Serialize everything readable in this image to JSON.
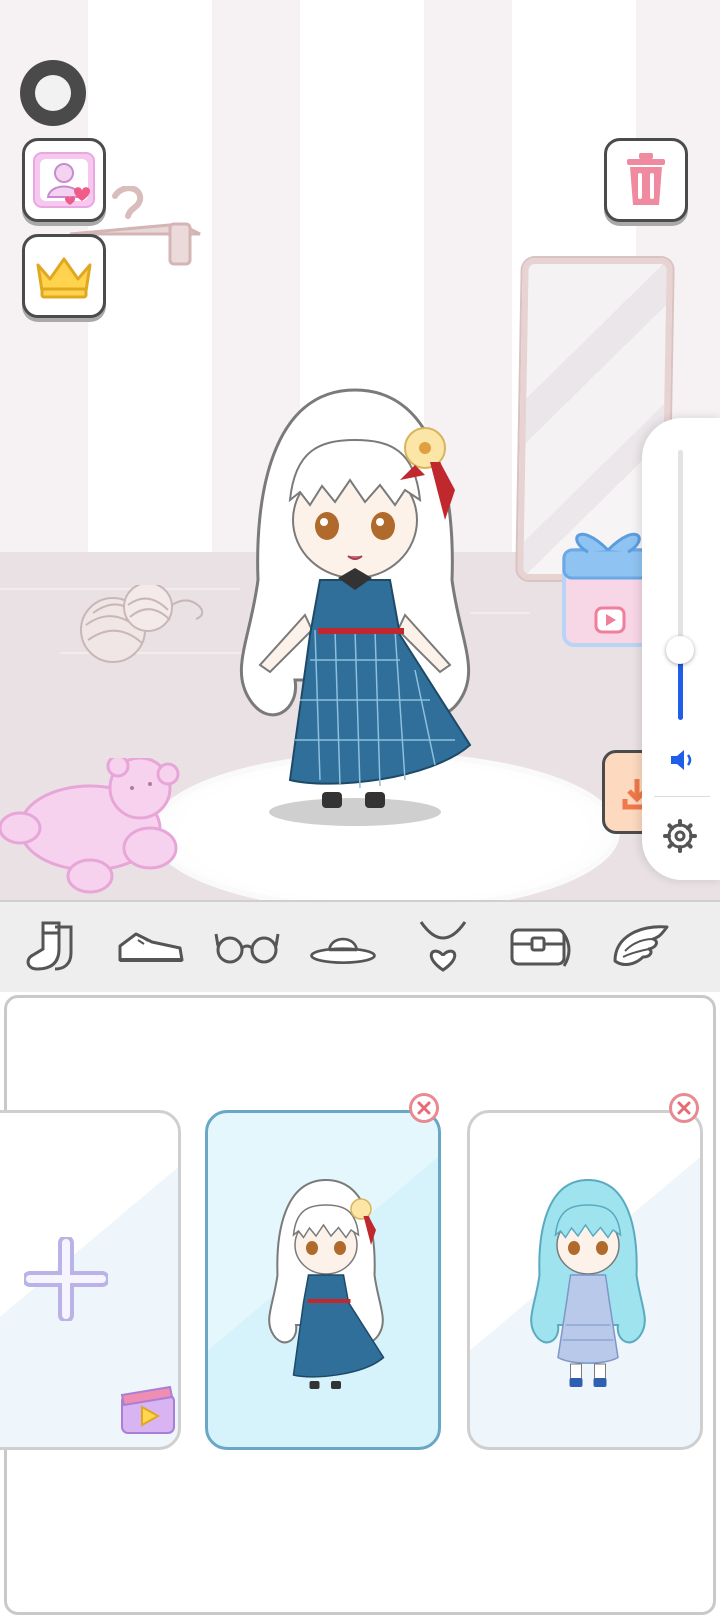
{
  "app": {
    "name": "doll-dressup"
  },
  "top_buttons": {
    "record": {
      "icon": "record-icon"
    },
    "gallery": {
      "icon": "gallery-heart-icon"
    },
    "vip": {
      "icon": "crown-icon"
    },
    "trash": {
      "icon": "trash-icon"
    }
  },
  "scene": {
    "objects": [
      "hanger",
      "mirror",
      "gift-box-video",
      "yarn-balls",
      "teddy-bear",
      "rug",
      "doll"
    ]
  },
  "volume": {
    "level": 0.26,
    "icon": "speaker-icon",
    "settings_icon": "gear-icon"
  },
  "categories": [
    {
      "name": "socks",
      "icon": "socks-icon"
    },
    {
      "name": "shoes",
      "icon": "shoes-icon"
    },
    {
      "name": "glasses",
      "icon": "glasses-icon"
    },
    {
      "name": "hat",
      "icon": "hat-icon"
    },
    {
      "name": "necklace",
      "icon": "necklace-icon"
    },
    {
      "name": "bag",
      "icon": "bag-icon"
    },
    {
      "name": "wings",
      "icon": "wings-icon"
    }
  ],
  "slots": [
    {
      "type": "add-new",
      "icon": "plus-icon",
      "badge": "video-ad-icon"
    },
    {
      "type": "character",
      "selected": true,
      "hair": "#ffffff",
      "dress": "#2f6f9a",
      "accent": "#c0282d"
    },
    {
      "type": "character",
      "selected": false,
      "hair": "#9fe3ef",
      "dress": "#9eb4dc",
      "accent": "#2f5fb0"
    }
  ],
  "colors": {
    "wall_stripe": "#f6f1f3",
    "floor": "#e9e1e3",
    "dark_outline": "#4b4b4b",
    "slider_blue": "#1e5ee8",
    "close_red": "#e88a91",
    "selected_card_border": "#6aa6c6"
  }
}
